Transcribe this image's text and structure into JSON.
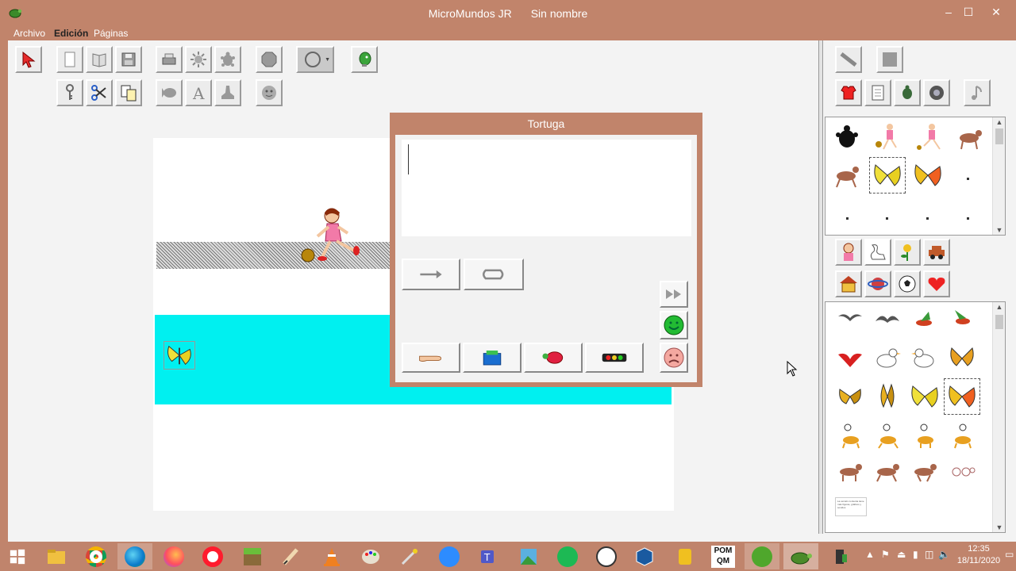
{
  "window": {
    "app_name": "MicroMundos JR",
    "document_name": "Sin nombre"
  },
  "menu": {
    "archivo": "Archivo",
    "edicion": "Edición",
    "paginas": "Páginas"
  },
  "dialog": {
    "title": "Tortuga"
  },
  "taskbar": {
    "time": "12:35",
    "date": "18/11/2020",
    "pom_label_1": "POM",
    "pom_label_2": "QM"
  },
  "library_note": "La versión contenta tiene más figuras, gráficos y sonidos",
  "colors": {
    "titlebar": "#c1846b",
    "water": "#00f0f0",
    "happy_face": "#22bb33",
    "sad_face": "#f4a8a0"
  }
}
